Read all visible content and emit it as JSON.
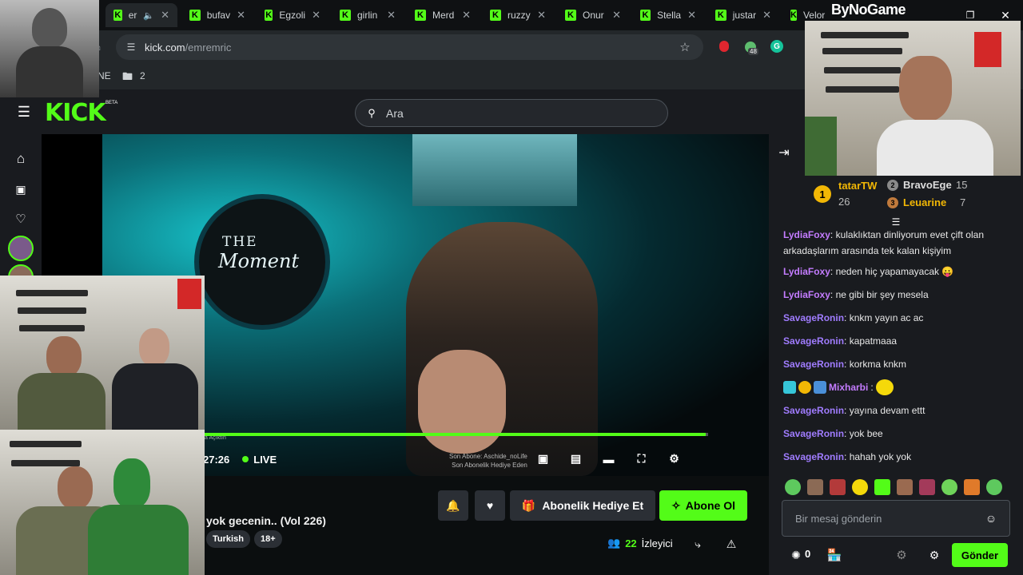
{
  "browser": {
    "tabs": [
      {
        "label": "er",
        "active": true
      },
      {
        "label": "bufav"
      },
      {
        "label": "Egzoli"
      },
      {
        "label": "girlin"
      },
      {
        "label": "Merd"
      },
      {
        "label": "ruzzy"
      },
      {
        "label": "Onur"
      },
      {
        "label": "Stella"
      },
      {
        "label": "justar"
      },
      {
        "label": "Velor"
      }
    ],
    "url_host": "kick.com",
    "url_path": "/emremric",
    "bookmark_fragment": "NE",
    "bookmark_folder_count": "2",
    "extension_badge": "48"
  },
  "overlay": {
    "brand_text": "ByNoGame"
  },
  "kick": {
    "logo": "KICK",
    "beta": "BETA",
    "search_placeholder": "Ara"
  },
  "player": {
    "time": "27:26",
    "live_label": "LIVE",
    "progress": 0.995,
    "overlay_line1": "Son Abone: Aschide_noLife",
    "overlay_line2": "Son Abonelik Hediye Eden",
    "overlay_small": "a Açıktın"
  },
  "stream": {
    "title": "yok gecenin.. (Vol 226)",
    "tags": [
      "Turkish",
      "18+"
    ],
    "gift_sub_label": "Abonelik Hediye Et",
    "subscribe_label": "Abone Ol",
    "viewer_count": "22",
    "viewer_label": "İzleyici"
  },
  "chat": {
    "leaderboard": [
      {
        "rank": "1",
        "name": "tatarTW",
        "count": "26"
      },
      {
        "rank": "2",
        "name": "BravoEge",
        "count": "15"
      },
      {
        "rank": "3",
        "name": "Leuarine",
        "count": "7"
      }
    ],
    "messages": [
      {
        "user": "LydiaFoxy",
        "color": "#c47cff",
        "text": ": kulaklıktan dinliyorum evet çift olan arkadaşlarım arasında tek kalan kişiyim"
      },
      {
        "user": "LydiaFoxy",
        "color": "#c47cff",
        "text": ": neden hiç yapamayacak 😛"
      },
      {
        "user": "LydiaFoxy",
        "color": "#c47cff",
        "text": ": ne gibi bir şey mesela"
      },
      {
        "user": "SavageRonin",
        "color": "#a07cff",
        "text": ": knkm yayın ac ac"
      },
      {
        "user": "SavageRonin",
        "color": "#a07cff",
        "text": ": kapatmaaa"
      },
      {
        "user": "SavageRonin",
        "color": "#a07cff",
        "text": ": korkma knkm"
      },
      {
        "user": "Mixharbi",
        "color": "#c47cff",
        "text": ":"
      },
      {
        "user": "SavageRonin",
        "color": "#a07cff",
        "text": ": yayına devam ettt"
      },
      {
        "user": "SavageRonin",
        "color": "#a07cff",
        "text": ": yok bee"
      },
      {
        "user": "SavageRonin",
        "color": "#a07cff",
        "text": ": hahah yok yok"
      }
    ],
    "input_placeholder": "Bir mesaj gönderin",
    "points": "0",
    "send_label": "Gönder"
  },
  "colors": {
    "accent": "#53fc18",
    "panel": "#191b1f"
  }
}
